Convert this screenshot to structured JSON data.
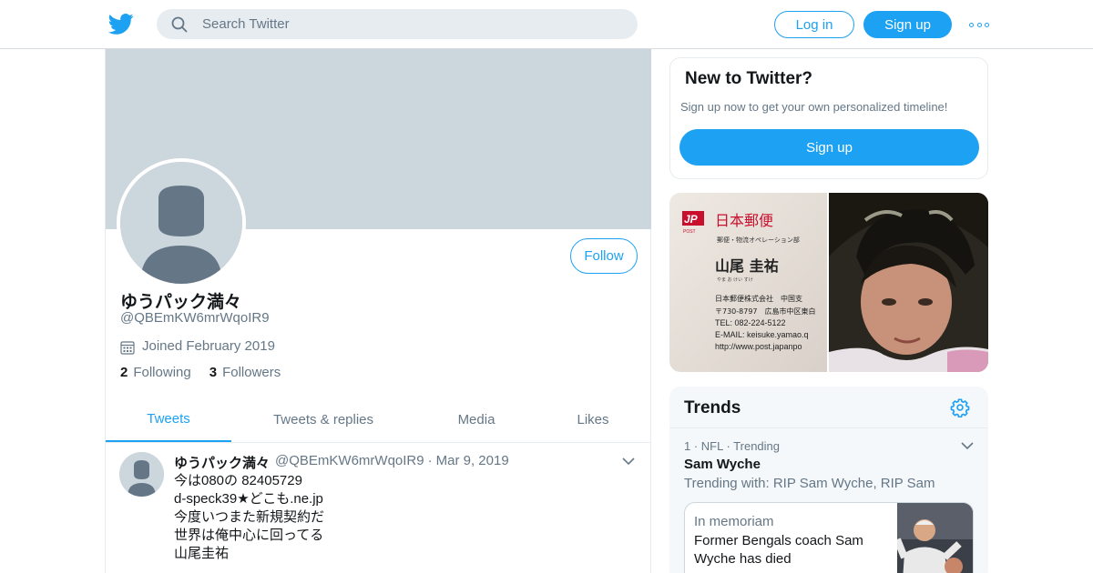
{
  "header": {
    "search_placeholder": "Search Twitter",
    "login_label": "Log in",
    "signup_label": "Sign up"
  },
  "profile": {
    "display_name": "ゆうパック満々",
    "handle": "@QBEmKW6mrWqoIR9",
    "joined": "Joined February 2019",
    "following_count": "2",
    "following_label": "Following",
    "followers_count": "3",
    "followers_label": "Followers",
    "follow_label": "Follow"
  },
  "tabs": [
    {
      "label": "Tweets",
      "active": true
    },
    {
      "label": "Tweets & replies",
      "active": false
    },
    {
      "label": "Media",
      "active": false
    },
    {
      "label": "Likes",
      "active": false
    }
  ],
  "tweet": {
    "name": "ゆうパック満々",
    "handle": "@QBEmKW6mrWqoIR9",
    "separator": "·",
    "date": "Mar 9, 2019",
    "lines": [
      "今は080の 82405729",
      "d-speck39★どこも.ne.jp",
      "今度いつまた新規契約だ",
      "世界は俺中心に回ってる",
      "山尾圭祐"
    ]
  },
  "signup_card": {
    "title": "New to Twitter?",
    "subtitle": "Sign up now to get your own personalized timeline!",
    "button_label": "Sign up"
  },
  "business_card": {
    "logo_text": "JP",
    "logo_sub": "POST",
    "company": "日本郵便",
    "department": "郵便・物流オペレーション部",
    "name": "山尾 圭祐",
    "reading": "やま お けい すけ",
    "corp": "日本郵便株式会社　中国支",
    "postal": "〒730-8797　広島市中区東白",
    "tel": "TEL: 082-224-5122",
    "email": "E-MAIL: keisuke.yamao.q",
    "url": "http://www.post.japanpo"
  },
  "trends": {
    "title": "Trends",
    "items": [
      {
        "meta": "1 · NFL · Trending",
        "name": "Sam Wyche",
        "with": "Trending with: RIP Sam Wyche, RIP Sam",
        "card_label": "In memoriam",
        "card_text": "Former Bengals coach Sam Wyche has died"
      }
    ]
  },
  "colors": {
    "accent": "#1da1f2",
    "banner": "#ccd6dd",
    "secondary_text": "#657786"
  },
  "icons": [
    "twitter-logo-icon",
    "search-icon",
    "more-icon",
    "calendar-icon",
    "chevron-down-icon",
    "gear-icon"
  ]
}
